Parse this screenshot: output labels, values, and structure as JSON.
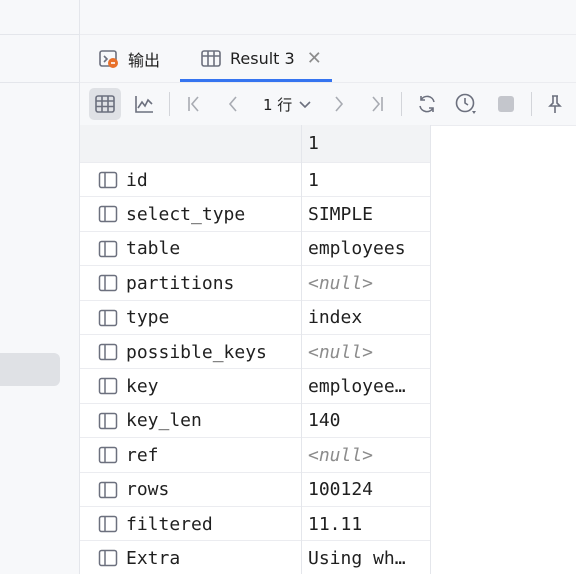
{
  "tabs": {
    "output_label": "输出",
    "result_label": "Result 3"
  },
  "toolbar": {
    "rows_label": "1 行"
  },
  "grid": {
    "header_value": "1",
    "rows": [
      {
        "name": "id",
        "value": "1",
        "null": false
      },
      {
        "name": "select_type",
        "value": "SIMPLE",
        "null": false
      },
      {
        "name": "table",
        "value": "employees",
        "null": false
      },
      {
        "name": "partitions",
        "value": "<null>",
        "null": true
      },
      {
        "name": "type",
        "value": "index",
        "null": false
      },
      {
        "name": "possible_keys",
        "value": "<null>",
        "null": true
      },
      {
        "name": "key",
        "value": "employee…",
        "null": false
      },
      {
        "name": "key_len",
        "value": "140",
        "null": false
      },
      {
        "name": "ref",
        "value": "<null>",
        "null": true
      },
      {
        "name": "rows",
        "value": "100124",
        "null": false
      },
      {
        "name": "filtered",
        "value": "11.11",
        "null": false
      },
      {
        "name": "Extra",
        "value": "Using wh…",
        "null": false
      }
    ]
  },
  "colors": {
    "accent": "#3574f0",
    "null_text": "#8c8c8c",
    "icon_gray": "#6c707e"
  },
  "icons": [
    "output-icon",
    "table-icon",
    "close-icon",
    "grid-view-icon",
    "chart-icon",
    "first-page-icon",
    "prev-page-icon",
    "chevron-down-icon",
    "next-page-icon",
    "last-page-icon",
    "reload-icon",
    "history-icon",
    "stop-icon",
    "pin-icon",
    "row-icon"
  ]
}
